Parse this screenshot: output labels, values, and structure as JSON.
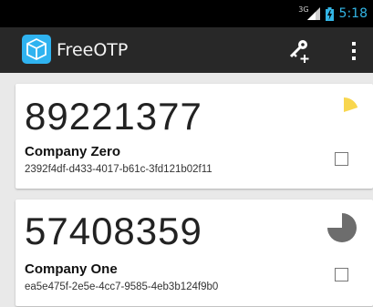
{
  "status_bar": {
    "network": "3G",
    "time": "5:18"
  },
  "app": {
    "title": "FreeOTP"
  },
  "colors": {
    "accent": "#33b5e5",
    "yellow": "#f8d64e",
    "gray_timer": "#6d6d6d"
  },
  "icons": {
    "app": "freeotp-cube-icon",
    "add": "add-token-key-icon",
    "menu": "overflow-menu-icon"
  },
  "tokens": [
    {
      "code": "89221377",
      "issuer": "Company Zero",
      "label": "2392f4df-d433-4017-b61c-3fd121b02f11",
      "timer_fraction": 0.2,
      "timer_color": "#f8d64e",
      "checked": false
    },
    {
      "code": "57408359",
      "issuer": "Company One",
      "label": "ea5e475f-2e5e-4cc7-9585-4eb3b124f9b0",
      "timer_fraction": 0.75,
      "timer_color": "#6d6d6d",
      "checked": false
    }
  ]
}
